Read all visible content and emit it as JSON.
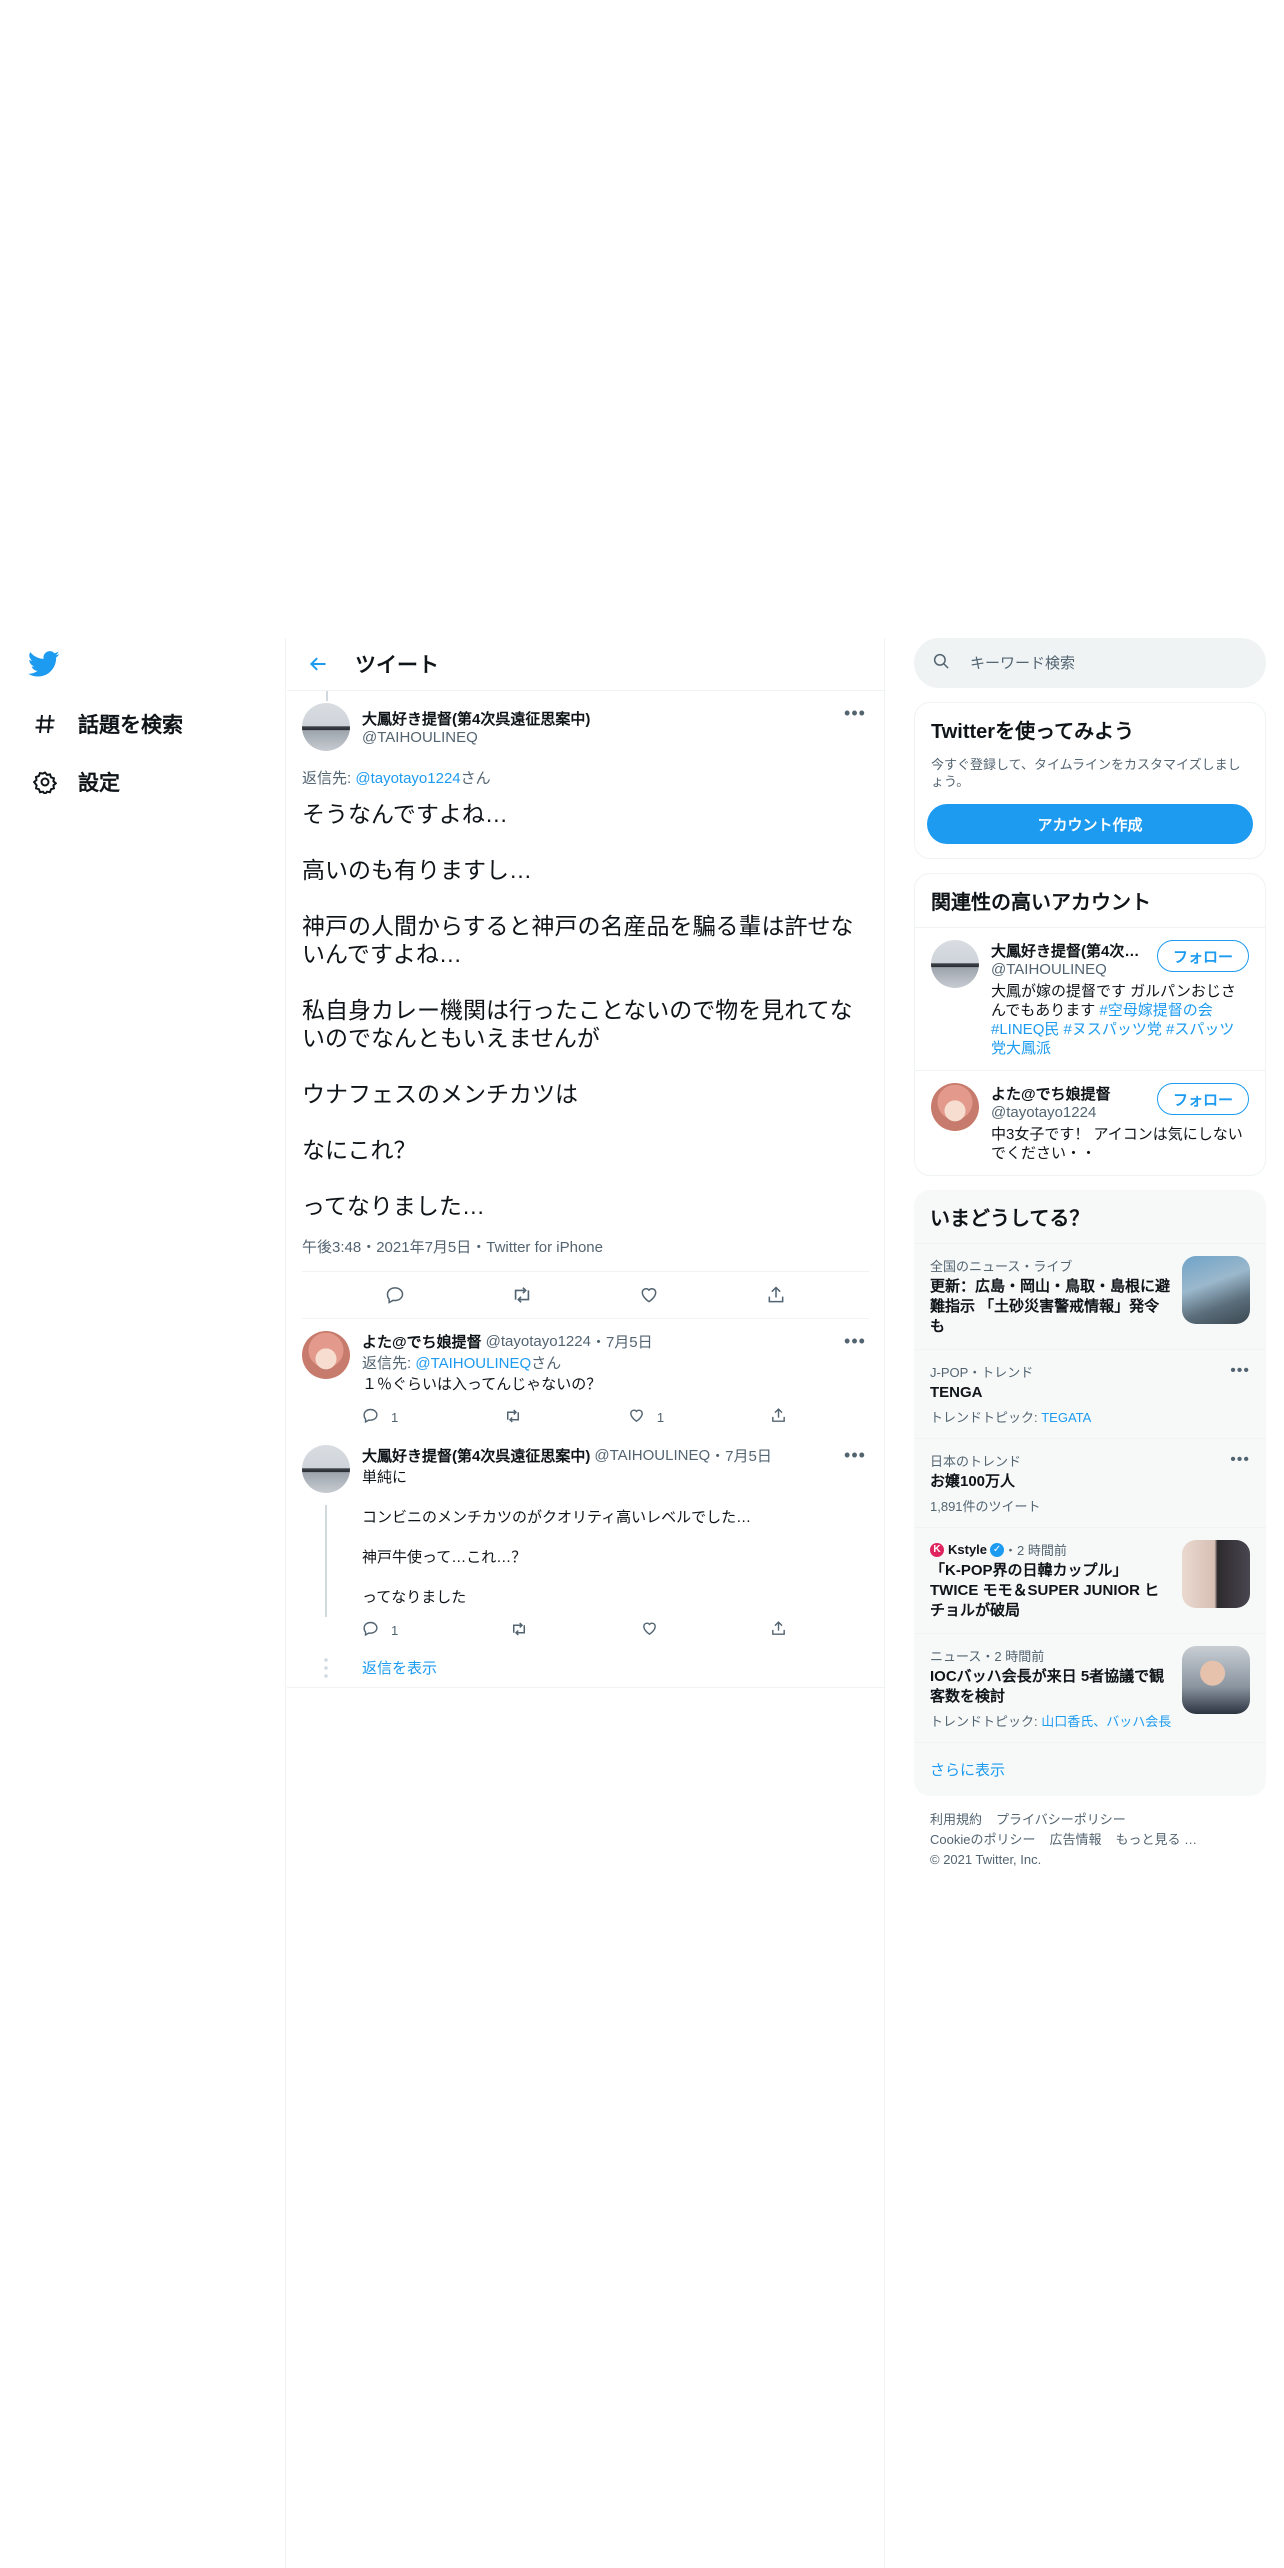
{
  "nav": {
    "explore": "話題を検索",
    "settings": "設定"
  },
  "main": {
    "title": "ツイート",
    "focal": {
      "name": "大鳳好き提督(第4次呉遠征思案中)",
      "handle": "@TAIHOULINEQ",
      "reply_prefix": "返信先: ",
      "reply_handle": "@tayotayo1224",
      "reply_suffix": "さん",
      "paragraphs": [
        "そうなんですよね…",
        "高いのも有りますし…",
        "神戸の人間からすると神戸の名産品を騙る輩は許せないんですよね…",
        "私自身カレー機関は行ったことないので物を見れてないのでなんともいえませんが",
        "ウナフェスのメンチカツは",
        "なにこれ？",
        "ってなりました…"
      ],
      "meta": "午後3:48・2021年7月5日・Twitter for iPhone"
    },
    "replies": [
      {
        "name": "よた@でち娘提督",
        "handle": "@tayotayo1224",
        "date": "・7月5日",
        "reply_prefix": "返信先: ",
        "reply_handle": "@TAIHOULINEQ",
        "reply_suffix": "さん",
        "text": "１％ぐらいは入ってんじゃないの？",
        "reply_count": "1",
        "like_count": "1"
      },
      {
        "name": "大鳳好き提督(第4次呉遠征思案中)",
        "handle": "@TAIHOULINEQ",
        "date": "・7月5日",
        "paragraphs": [
          "単純に",
          "コンビニのメンチカツのがクオリティ高いレベルでした…",
          "神戸牛使って…これ…？",
          "ってなりました"
        ],
        "reply_count": "1"
      }
    ],
    "show_replies": "返信を表示"
  },
  "sidebar": {
    "search_placeholder": "キーワード検索",
    "signup": {
      "title": "Twitterを使ってみよう",
      "subtitle": "今すぐ登録して、タイムラインをカスタマイズしましょう。",
      "button": "アカウント作成"
    },
    "relevant": {
      "title": "関連性の高いアカウント",
      "accounts": [
        {
          "name": "大鳳好き提督(第4次…",
          "handle": "@TAIHOULINEQ",
          "follow": "フォロー",
          "bio_text": "大鳳が嫁の提督です ガルパンおじさんでもあります ",
          "bio_tags": "#空母嫁提督の会 #LINEQ民 #ヌスパッツ党 #スパッツ党大鳳派"
        },
        {
          "name": "よた@でち娘提督",
          "handle": "@tayotayo1224",
          "follow": "フォロー",
          "bio_text": "中3女子です！ アイコンは気にしないでください・・"
        }
      ]
    },
    "trends": {
      "title": "いまどうしてる？",
      "items": [
        {
          "category": "全国のニュース・ライブ",
          "title": "更新：広島・岡山・鳥取・島根に避難指示 「土砂災害警戒情報」発令も"
        },
        {
          "category": "J-POP・トレンド",
          "title": "TENGA",
          "sub_prefix": "トレンドトピック: ",
          "sub_link": "TEGATA"
        },
        {
          "category": "日本のトレンド",
          "title": "お嬢100万人",
          "sub": "1,891件のツイート"
        },
        {
          "source": "Kstyle",
          "time": "・2 時間前",
          "title": "「K-POP界の日韓カップル」TWICE モモ＆SUPER JUNIOR ヒチョルが破局"
        },
        {
          "category": "ニュース・2 時間前",
          "title": "IOCバッハ会長が来日 5者協議で観客数を検討",
          "sub_prefix": "トレンドトピック: ",
          "sub_link": "山口香氏、バッハ会長"
        }
      ],
      "show_more": "さらに表示"
    },
    "footer": {
      "terms": "利用規約",
      "privacy": "プライバシーポリシー",
      "cookie": "Cookieのポリシー",
      "ads": "広告情報",
      "more": "もっと見る …",
      "copyright": "© 2021 Twitter, Inc."
    }
  },
  "colors": {
    "accent": "#1d9bf0",
    "text": "#0f1419",
    "muted": "#536471",
    "border": "#eff3f4"
  }
}
